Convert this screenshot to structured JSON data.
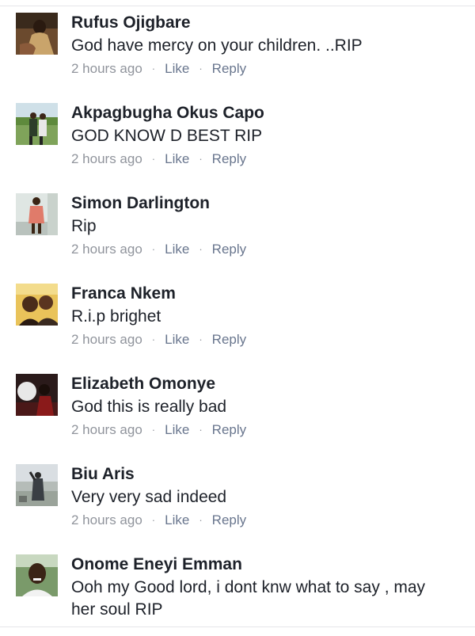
{
  "comments": [
    {
      "name": "Rufus Ojigbare",
      "text": "God have mercy on your children. ..RIP",
      "time": "2 hours ago",
      "like": "Like",
      "reply": "Reply"
    },
    {
      "name": "Akpagbugha Okus Capo",
      "text": "GOD KNOW D BEST RIP",
      "time": "2 hours ago",
      "like": "Like",
      "reply": "Reply"
    },
    {
      "name": "Simon Darlington",
      "text": "Rip",
      "time": "2 hours ago",
      "like": "Like",
      "reply": "Reply"
    },
    {
      "name": "Franca Nkem",
      "text": "R.i.p brighet",
      "time": "2 hours ago",
      "like": "Like",
      "reply": "Reply"
    },
    {
      "name": "Elizabeth Omonye",
      "text": "God this is really bad",
      "time": "2 hours ago",
      "like": "Like",
      "reply": "Reply"
    },
    {
      "name": "Biu Aris",
      "text": "Very very sad indeed",
      "time": "2 hours ago",
      "like": "Like",
      "reply": "Reply"
    },
    {
      "name": "Onome Eneyi Emman",
      "text": "Ooh my Good lord, i dont knw what to say , may her soul RIP"
    }
  ],
  "separator": "·"
}
